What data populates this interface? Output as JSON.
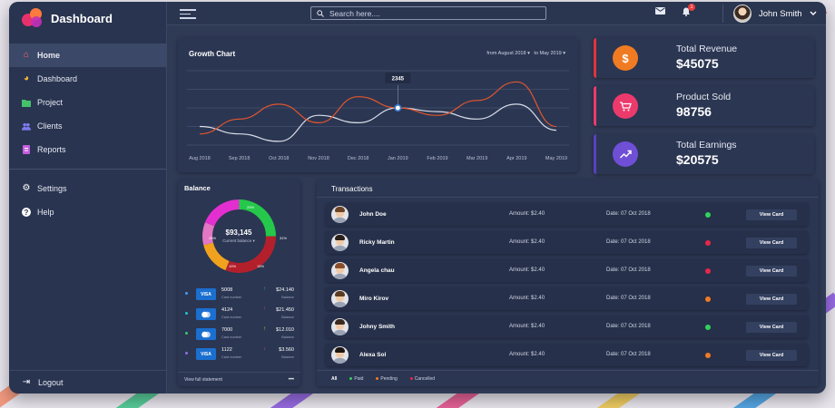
{
  "app": {
    "title": "Dashboard"
  },
  "sidebar": {
    "items": [
      {
        "label": "Home",
        "icon": "home-icon",
        "color": "#ff6b6b",
        "active": true
      },
      {
        "label": "Dashboard",
        "icon": "dashboard-icon",
        "color": "#f6b73c"
      },
      {
        "label": "Project",
        "icon": "folder-icon",
        "color": "#43c26b"
      },
      {
        "label": "Clients",
        "icon": "users-icon",
        "color": "#7c7cf0"
      },
      {
        "label": "Reports",
        "icon": "reports-icon",
        "color": "#c35de0"
      }
    ],
    "secondary": [
      {
        "label": "Settings",
        "icon": "gear-icon"
      },
      {
        "label": "Help",
        "icon": "help-icon"
      }
    ],
    "logout": "Logout"
  },
  "topbar": {
    "search_placeholder": "Search here....",
    "notification_count": "1",
    "user_name": "John Smith"
  },
  "growth_chart": {
    "title": "Growth Chart",
    "range_from": "from  August 2018",
    "range_to": "to  May 2019",
    "tooltip": "2345"
  },
  "chart_data": {
    "type": "line",
    "title": "Growth Chart",
    "categories": [
      "Aug 2018",
      "Sep 2018",
      "Oct 2018",
      "Nov 2018",
      "Dec 2018",
      "Jan 2019",
      "Feb 2019",
      "Mar 2019",
      "Apr 2019",
      "May 2019"
    ],
    "series": [
      {
        "color": "#d9dde8",
        "values": [
          0.25,
          0.15,
          0.05,
          0.4,
          0.3,
          0.5,
          0.45,
          0.35,
          0.55,
          0.2
        ]
      },
      {
        "color": "#e2562e",
        "values": [
          0.15,
          0.35,
          0.55,
          0.3,
          0.65,
          0.5,
          0.4,
          0.6,
          0.85,
          0.25
        ]
      }
    ],
    "highlight": {
      "x": "Jan 2019",
      "value": "2345"
    },
    "grid": true,
    "colors": {
      "accent": "#3a7bd5"
    }
  },
  "stats": [
    {
      "label": "Total Revenue",
      "value": "$45075",
      "icon": "dollar-icon",
      "symbol": "$",
      "color": "#f07b22"
    },
    {
      "label": "Product Sold",
      "value": "98756",
      "icon": "cart-icon",
      "symbol": "🛒",
      "color": "#ec3a6d"
    },
    {
      "label": "Total Earnings",
      "value": "$20575",
      "icon": "trend-icon",
      "symbol": "⇗",
      "color": "#6f4fd6"
    }
  ],
  "balance": {
    "title": "Balance",
    "amount": "$93,145",
    "subtitle": "Current balance ▾",
    "segments": [
      {
        "pct": "25%",
        "color": "#25c84a",
        "value": 25
      },
      {
        "pct": "31%",
        "color": "#b3202c",
        "value": 31
      },
      {
        "pct": "15%",
        "color": "#f0a21e",
        "value": 15
      },
      {
        "pct": "10%",
        "color": "#e277c4",
        "value": 10
      },
      {
        "pct": "25%",
        "color": "#e42fd0",
        "value": 19
      }
    ],
    "cards": [
      {
        "number": "5008",
        "brand": "VISA",
        "label": "Card number",
        "amount": "$24.140",
        "amount_label": "Balance",
        "dot": "#3aa0ff",
        "arrow": "↑",
        "arrow_color": "#25c84a"
      },
      {
        "number": "4124",
        "brand": "MC",
        "label": "Card number",
        "amount": "$21.450",
        "amount_label": "Balance",
        "dot": "#1ec7c7",
        "arrow": "↑",
        "arrow_color": "#e42fd0"
      },
      {
        "number": "7000",
        "brand": "MC",
        "label": "Card number",
        "amount": "$12.010",
        "amount_label": "Balance",
        "dot": "#3ac76b",
        "arrow": "↑",
        "arrow_color": "#f0d01e"
      },
      {
        "number": "1122",
        "brand": "VISA",
        "label": "Card number",
        "amount": "$3.560",
        "amount_label": "Balance",
        "dot": "#8f6ee0",
        "arrow": "↓",
        "arrow_color": "#e42fd0"
      }
    ],
    "statement": "View full statement",
    "more": "•••"
  },
  "transactions": {
    "title": "Transactions",
    "rows": [
      {
        "name": "John Doe",
        "amount": "Amount: $2.40",
        "date": "Date: 07 Oct 2018",
        "status": "#2fd35a",
        "button": "View Card",
        "hair": "#6b4326"
      },
      {
        "name": "Ricky Martin",
        "amount": "Amount: $2.40",
        "date": "Date: 07 Oct 2018",
        "status": "#e8264a",
        "button": "View Card",
        "hair": "#2a1e18"
      },
      {
        "name": "Angela chau",
        "amount": "Amount: $2.40",
        "date": "Date: 07 Oct 2018",
        "status": "#e8264a",
        "button": "View Card",
        "hair": "#8a4d2a"
      },
      {
        "name": "Miro Kirov",
        "amount": "Amount: $2.40",
        "date": "Date: 07 Oct 2018",
        "status": "#f07b22",
        "button": "View Card",
        "hair": "#5b3b22"
      },
      {
        "name": "Johny Smith",
        "amount": "Amount: $2.40",
        "date": "Date: 07 Oct 2018",
        "status": "#2fd35a",
        "button": "View Card",
        "hair": "#3a2a22"
      },
      {
        "name": "Alexa Sol",
        "amount": "Amount: $2.40",
        "date": "Date: 07 Oct 2018",
        "status": "#f07b22",
        "button": "View Card",
        "hair": "#1d1611"
      }
    ],
    "filters": [
      {
        "label": "All"
      },
      {
        "label": "Paid",
        "color": "#2fd35a"
      },
      {
        "label": "Pending",
        "color": "#f07b22"
      },
      {
        "label": "Cancelled",
        "color": "#e8264a"
      }
    ]
  }
}
